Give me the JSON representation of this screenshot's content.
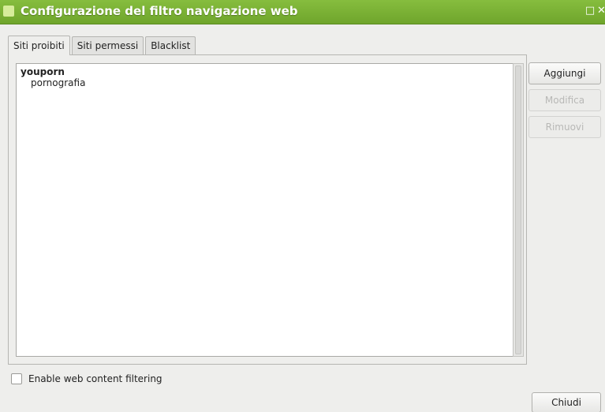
{
  "window": {
    "title": "Configurazione del filtro navigazione web",
    "maximize_glyph": "□",
    "close_glyph": "✕"
  },
  "tabs": [
    {
      "label": "Siti proibiti",
      "active": true
    },
    {
      "label": "Siti permessi",
      "active": false
    },
    {
      "label": "Blacklist",
      "active": false
    }
  ],
  "site_list": {
    "items": [
      {
        "title": "youporn",
        "category": "pornografia"
      }
    ]
  },
  "side_buttons": {
    "add_label": "Aggiungi",
    "edit_label": "Modifica",
    "remove_label": "Rimuovi"
  },
  "footer": {
    "enable_filter_label": "Enable web content filtering",
    "enable_filter_checked": false,
    "close_label": "Chiudi"
  },
  "colors": {
    "titlebar": "#7ab236",
    "window_bg": "#eeeeec"
  }
}
